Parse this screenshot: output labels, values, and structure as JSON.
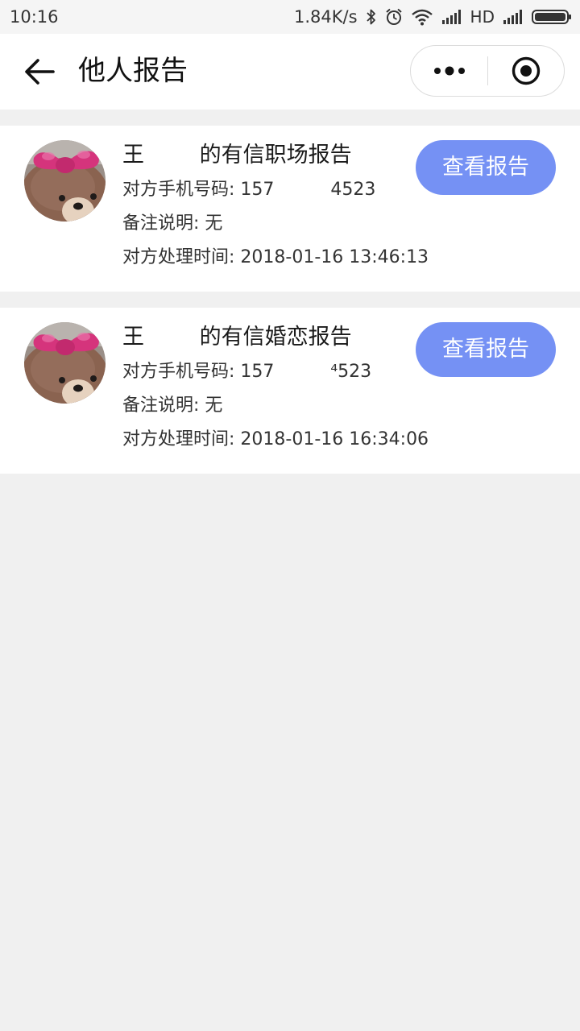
{
  "status_bar": {
    "time": "10:16",
    "network_speed": "1.84K/s",
    "hd_label": "HD",
    "icons": [
      "bluetooth-icon",
      "alarm-icon",
      "wifi-icon",
      "signal-icon",
      "signal-icon",
      "battery-icon"
    ]
  },
  "navbar": {
    "title": "他人报告",
    "back_icon": "arrow-left-icon",
    "more_icon": "more-dots-icon",
    "close_icon": "target-circle-icon"
  },
  "colors": {
    "accent_button": "#7591f4",
    "page_background": "#f0f0f0",
    "card_background": "#ffffff"
  },
  "reports": [
    {
      "title": "王        的有信职场报告",
      "phone_line": "对方手机号码: 157          4523",
      "note_line": "备注说明: 无",
      "time_line": "对方处理时间: 2018-01-16 13:46:13",
      "button_label": "查看报告"
    },
    {
      "title": "王        的有信婚恋报告",
      "phone_line": "对方手机号码: 157          ⁴523",
      "note_line": "备注说明: 无",
      "time_line": "对方处理时间: 2018-01-16 16:34:06",
      "button_label": "查看报告"
    }
  ]
}
